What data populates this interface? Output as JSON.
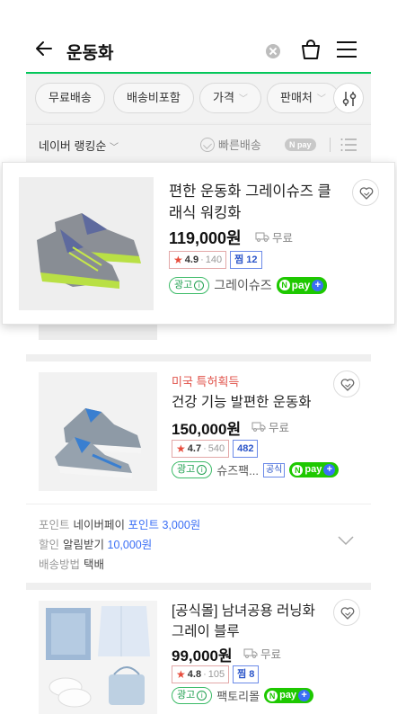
{
  "header": {
    "title": "운동화"
  },
  "filters": [
    {
      "label": "무료배송",
      "dropdown": false
    },
    {
      "label": "배송비포함",
      "dropdown": false
    },
    {
      "label": "가격",
      "dropdown": true
    },
    {
      "label": "판매처",
      "dropdown": true
    }
  ],
  "sortbar": {
    "sort_label": "네이버 랭킹순",
    "fast_label": "빠른배송",
    "npay_label": "N pay"
  },
  "products": [
    {
      "name_line1": "편한 운동화 그레이슈즈 클",
      "name_line2": "래식 워킹화",
      "price": "119,000원",
      "shipping": "무료",
      "rating": "4.9",
      "rating_count": "140",
      "zzim_label": "찜",
      "zzim_count": "12",
      "ad_label": "광고",
      "seller": "그레이슈즈",
      "npay": "pay"
    },
    {
      "badge": "미국 특허획득",
      "name_line1": "건강 기능 발편한 운동화",
      "price": "150,000원",
      "shipping": "무료",
      "rating": "4.7",
      "rating_count": "540",
      "zzim_count": "482",
      "ad_label": "광고",
      "seller": "슈즈팩...",
      "official": "공식",
      "npay": "pay"
    },
    {
      "name_line1": "[공식몰] 남녀공용 러닝화",
      "name_line2": "그레이 블루",
      "price": "99,000원",
      "shipping": "무료",
      "rating": "4.8",
      "rating_count": "105",
      "zzim_label": "찜",
      "zzim_count": "8",
      "ad_label": "광고",
      "seller": "팩토리몰",
      "npay": "pay"
    }
  ],
  "points": {
    "row1_key": "포인트",
    "row1_value": "네이버페이",
    "row1_blue": "포인트 3,000원",
    "row2_key": "할인",
    "row2_value": "알림받기",
    "row2_blue": "10,000원",
    "row3_key": "배송방법",
    "row3_value": "택배"
  },
  "colors": {
    "naver_green": "#03c75a",
    "npay_green": "#1ec800",
    "star_red": "#e74c3c",
    "link_blue": "#3b6ff5"
  }
}
